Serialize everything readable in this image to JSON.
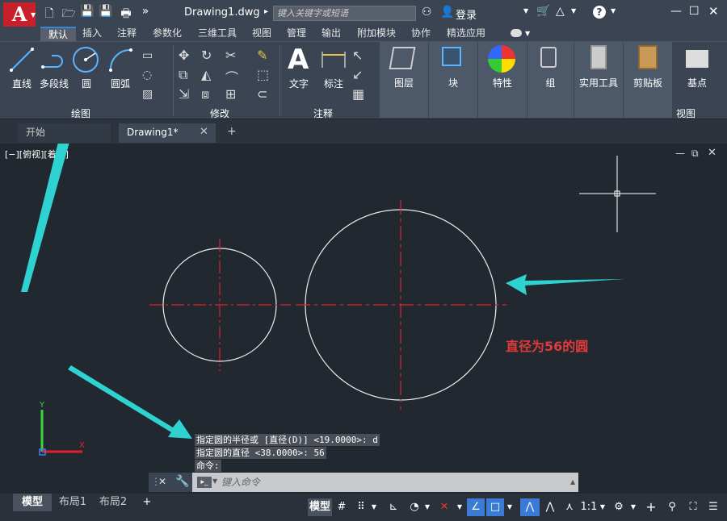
{
  "app": {
    "logo": "A",
    "document_title": "Drawing1.dwg",
    "search_placeholder": "键入关键字或短语",
    "login": "登录"
  },
  "window_controls": {
    "minimize": "—",
    "maximize": "☐",
    "close": "✕"
  },
  "ribbon_tabs": [
    "默认",
    "插入",
    "注释",
    "参数化",
    "三维工具",
    "视图",
    "管理",
    "输出",
    "附加模块",
    "协作",
    "精选应用"
  ],
  "draw_panel": {
    "line": "直线",
    "polyline": "多段线",
    "circle": "圆",
    "arc": "圆弧",
    "title": "绘图"
  },
  "modify_panel": {
    "title": "修改"
  },
  "annotation_panel": {
    "text": "文字",
    "dimension": "标注",
    "title": "注释"
  },
  "big_buttons": {
    "layers": "图层",
    "block": "块",
    "properties": "特性",
    "groups": "组",
    "utilities": "实用工具",
    "clipboard": "剪贴板",
    "base": "基点",
    "view": "视图"
  },
  "file_tabs": {
    "start": "开始",
    "drawing": "Drawing1*",
    "add": "+"
  },
  "viewport_label": "[−][俯视][着色]",
  "annotation_text": "直径为56的圆",
  "command_history": [
    "指定圆的半径或 [直径(D)] <19.0000>: d",
    "指定圆的直径 <38.0000>: 56",
    "命令:"
  ],
  "command_placeholder": "键入命令",
  "layout_tabs": [
    "模型",
    "布局1",
    "布局2"
  ],
  "status": {
    "model": "模型",
    "scale": "1:1"
  },
  "colors": {
    "arrow": "#2ed3d1",
    "centerline": "#e0202a",
    "annotation": "#e23a3a",
    "logo": "#c8202a"
  }
}
